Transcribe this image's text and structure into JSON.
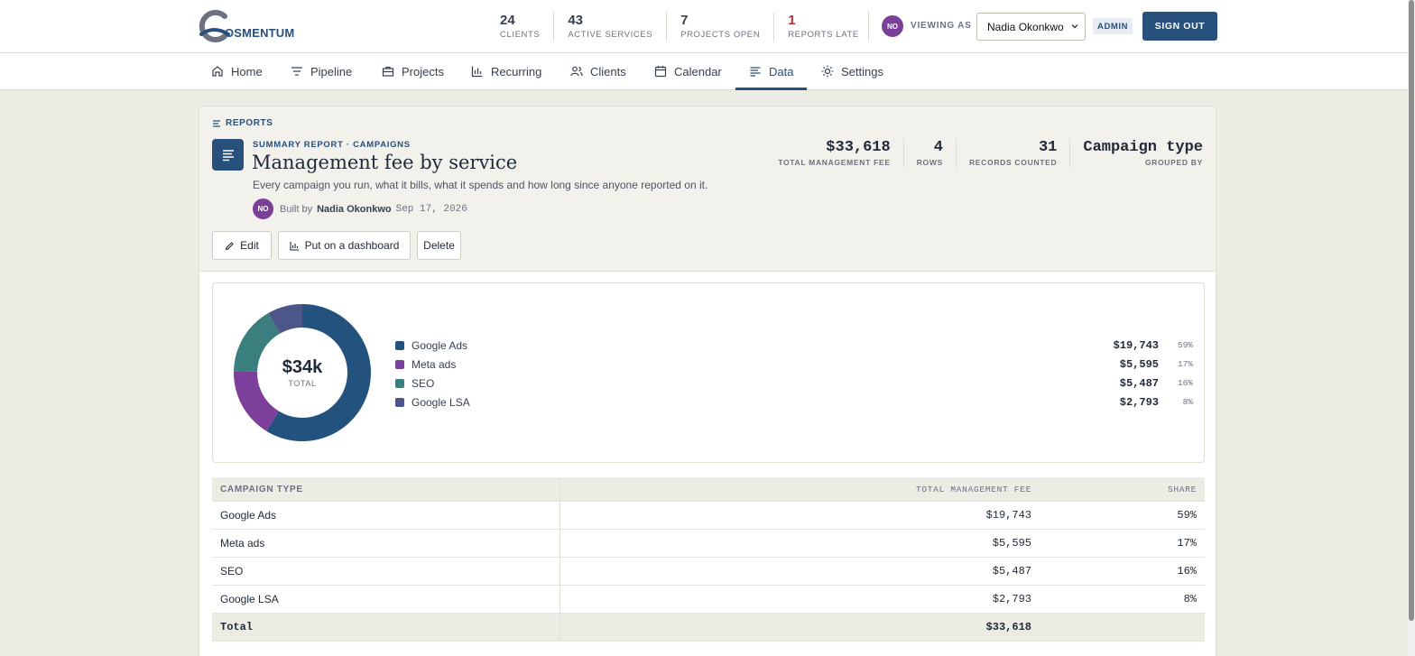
{
  "brand": {
    "name": "OSMENTUM"
  },
  "stats": [
    {
      "value": "24",
      "label": "CLIENTS"
    },
    {
      "value": "43",
      "label": "ACTIVE SERVICES"
    },
    {
      "value": "7",
      "label": "PROJECTS OPEN"
    },
    {
      "value": "1",
      "label": "REPORTS LATE"
    }
  ],
  "user": {
    "initials": "NO",
    "viewing_label": "VIEWING AS",
    "selected": "Nadia Okonkwo",
    "role": "ADMIN",
    "sign_out": "SIGN OUT"
  },
  "nav": [
    {
      "label": "Home",
      "icon": "home-icon"
    },
    {
      "label": "Pipeline",
      "icon": "filter-icon"
    },
    {
      "label": "Projects",
      "icon": "briefcase-icon"
    },
    {
      "label": "Recurring",
      "icon": "bar-chart-icon"
    },
    {
      "label": "Clients",
      "icon": "users-icon"
    },
    {
      "label": "Calendar",
      "icon": "calendar-icon"
    },
    {
      "label": "Data",
      "icon": "list-icon",
      "active": true
    },
    {
      "label": "Settings",
      "icon": "sun-icon"
    }
  ],
  "report": {
    "crumb": "REPORTS",
    "kicker": "SUMMARY REPORT · CAMPAIGNS",
    "title": "Management fee by service",
    "description": "Every campaign you run, what it bills, what it spends and how long since anyone reported on it.",
    "built_by_prefix": "Built by",
    "author_initials": "NO",
    "author": "Nadia Okonkwo",
    "date": "Sep 17, 2026",
    "kpis": [
      {
        "value": "$33,618",
        "label": "TOTAL MANAGEMENT FEE"
      },
      {
        "value": "4",
        "label": "ROWS"
      },
      {
        "value": "31",
        "label": "RECORDS COUNTED"
      },
      {
        "value": "Campaign type",
        "label": "GROUPED BY"
      }
    ],
    "actions": {
      "edit": "Edit",
      "dashboard": "Put on a dashboard",
      "delete": "Delete"
    }
  },
  "colors": {
    "primary": "#27507d",
    "late": "#b83232"
  },
  "chart_data": {
    "type": "pie",
    "center_value": "$34k",
    "center_label": "TOTAL",
    "categories": [
      "Google Ads",
      "Meta ads",
      "SEO",
      "Google LSA"
    ],
    "values": [
      19743,
      5595,
      5487,
      2793
    ],
    "value_labels": [
      "$19,743",
      "$5,595",
      "$5,487",
      "$2,793"
    ],
    "percent_labels": [
      "59%",
      "17%",
      "16%",
      "8%"
    ],
    "colors": [
      "#23527f",
      "#7d3f9c",
      "#3a7f7d",
      "#4c5688"
    ]
  },
  "table": {
    "columns": [
      "CAMPAIGN TYPE",
      "TOTAL MANAGEMENT FEE",
      "SHARE"
    ],
    "rows": [
      [
        "Google Ads",
        "$19,743",
        "59%"
      ],
      [
        "Meta ads",
        "$5,595",
        "17%"
      ],
      [
        "SEO",
        "$5,487",
        "16%"
      ],
      [
        "Google LSA",
        "$2,793",
        "8%"
      ]
    ],
    "total": {
      "label": "Total",
      "value": "$33,618"
    }
  }
}
